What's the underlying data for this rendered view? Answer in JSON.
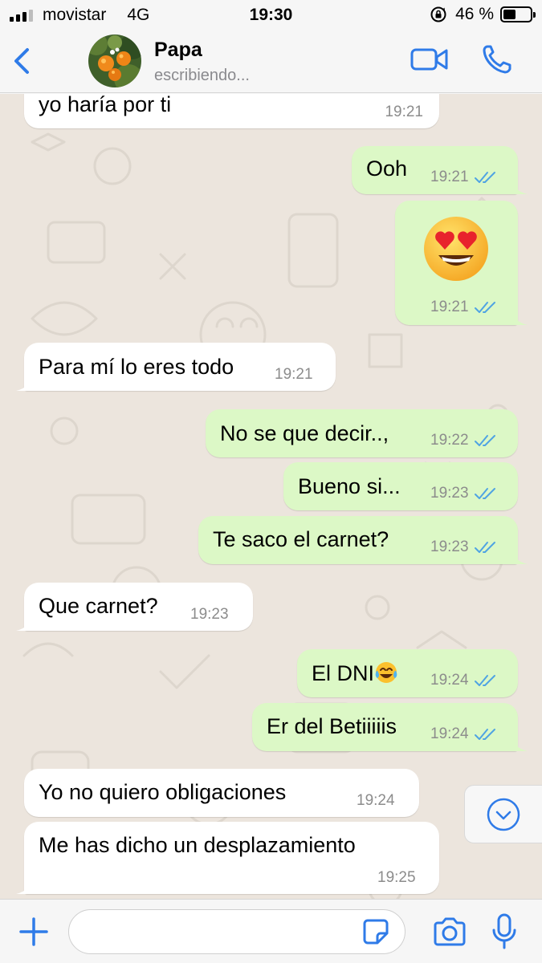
{
  "status_bar": {
    "carrier": "movistar",
    "network": "4G",
    "time": "19:30",
    "battery_percent": "46 %",
    "battery_level": 0.46
  },
  "header": {
    "contact_name": "Papa",
    "contact_status": "escribiendo..."
  },
  "messages": [
    {
      "direction": "in",
      "text": "yo haría por ti",
      "time": "19:21"
    },
    {
      "direction": "out",
      "text": "Ooh",
      "time": "19:21",
      "read": true
    },
    {
      "direction": "out",
      "emoji": "smiling-face-with-heart-eyes",
      "time": "19:21",
      "read": true
    },
    {
      "direction": "in",
      "text": "Para mí lo eres todo",
      "time": "19:21"
    },
    {
      "direction": "out",
      "text": "No se que decir..,",
      "time": "19:22",
      "read": true
    },
    {
      "direction": "out",
      "text": "Bueno si...",
      "time": "19:23",
      "read": true
    },
    {
      "direction": "out",
      "text": "Te saco el carnet?",
      "time": "19:23",
      "read": true
    },
    {
      "direction": "in",
      "text": "Que carnet?",
      "time": "19:23"
    },
    {
      "direction": "out",
      "text": "El DNI",
      "emoji": "face-with-tears-of-joy",
      "time": "19:24",
      "read": true
    },
    {
      "direction": "out",
      "text": "Er del Betiiiiis",
      "time": "19:24",
      "read": true
    },
    {
      "direction": "in",
      "text": "Yo no quiero obligaciones",
      "time": "19:24"
    },
    {
      "direction": "in",
      "text": "Me has dicho un desplazamiento",
      "time": "19:25"
    }
  ],
  "input": {
    "placeholder": "",
    "value": ""
  },
  "colors": {
    "accent": "#2f7be8",
    "outgoing_bubble": "#dcf8c6",
    "incoming_bubble": "#ffffff",
    "chat_background": "#ece5dd",
    "read_ticks": "#4fa3e3"
  }
}
